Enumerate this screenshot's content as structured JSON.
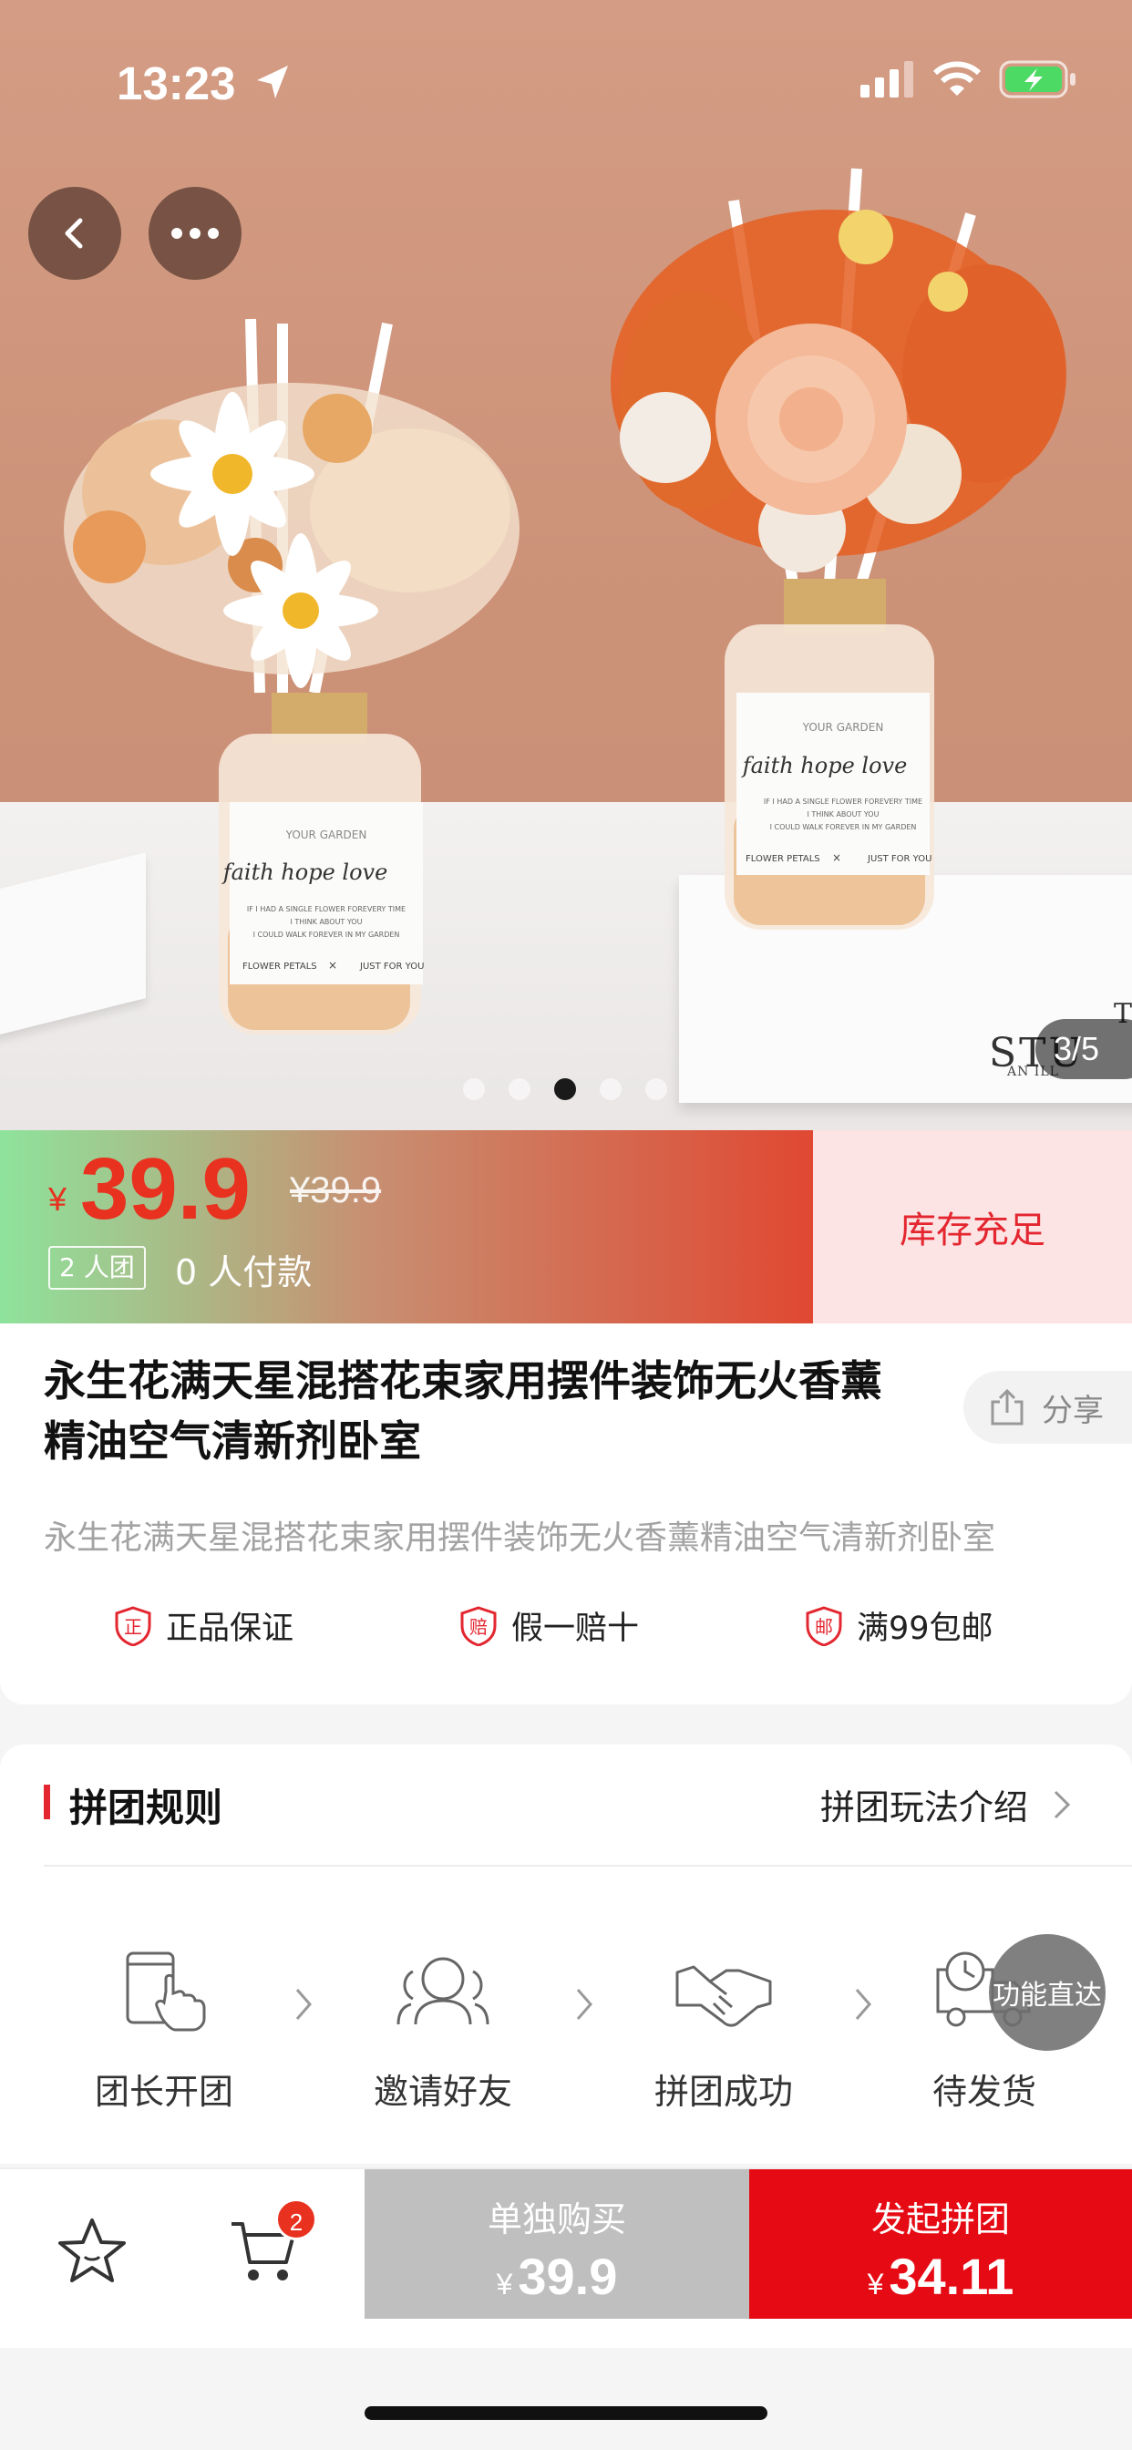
{
  "status_bar": {
    "time": "13:23"
  },
  "gallery": {
    "page_indicator": "3/5",
    "dot_count": 5,
    "active_dot": 3,
    "image_text": {
      "brand": "YOUR GARDEN",
      "script": "faith hope love",
      "line1": "IF I HAD A SINGLE FLOWER FOREVERY TIME",
      "line2": "I THINK ABOUT YOU",
      "line3": "I COULD WALK FOREVER IN MY GARDEN",
      "left_label": "FLOWER PETALS",
      "cross": "×",
      "right_label": "JUST FOR YOU",
      "box_text": "STU",
      "box_sub": "AN ILL",
      "box_corner": "T"
    }
  },
  "price": {
    "currency": "¥",
    "current": "39.9",
    "original": "¥39.9",
    "group_tag": "2 人团",
    "paid": "0 人付款",
    "stock": "库存充足"
  },
  "product": {
    "title": "永生花满天星混搭花束家用摆件装饰无火香薰精油空气清新剂卧室",
    "subtitle": "永生花满天星混搭花束家用摆件装饰无火香薰精油空气清新剂卧室",
    "share_label": "分享",
    "guarantees": [
      {
        "icon": "正",
        "label": "正品保证"
      },
      {
        "icon": "赔",
        "label": "假一赔十"
      },
      {
        "icon": "邮",
        "label": "满99包邮"
      }
    ]
  },
  "rules": {
    "title": "拼团规则",
    "link": "拼团玩法介绍",
    "steps": [
      "团长开团",
      "邀请好友",
      "拼团成功",
      "待发货"
    ],
    "float_button": "功能直达"
  },
  "bottom": {
    "cart_count": "2",
    "solo_label": "单独购买",
    "solo_currency": "¥",
    "solo_price": "39.9",
    "group_label": "发起拼团",
    "group_currency": "¥",
    "group_price": "34.11"
  },
  "colors": {
    "accent_red": "#e60a14",
    "price_red": "#e8321f",
    "stock_bg": "#fde4e4",
    "solo_gray": "#bfbfbf"
  }
}
